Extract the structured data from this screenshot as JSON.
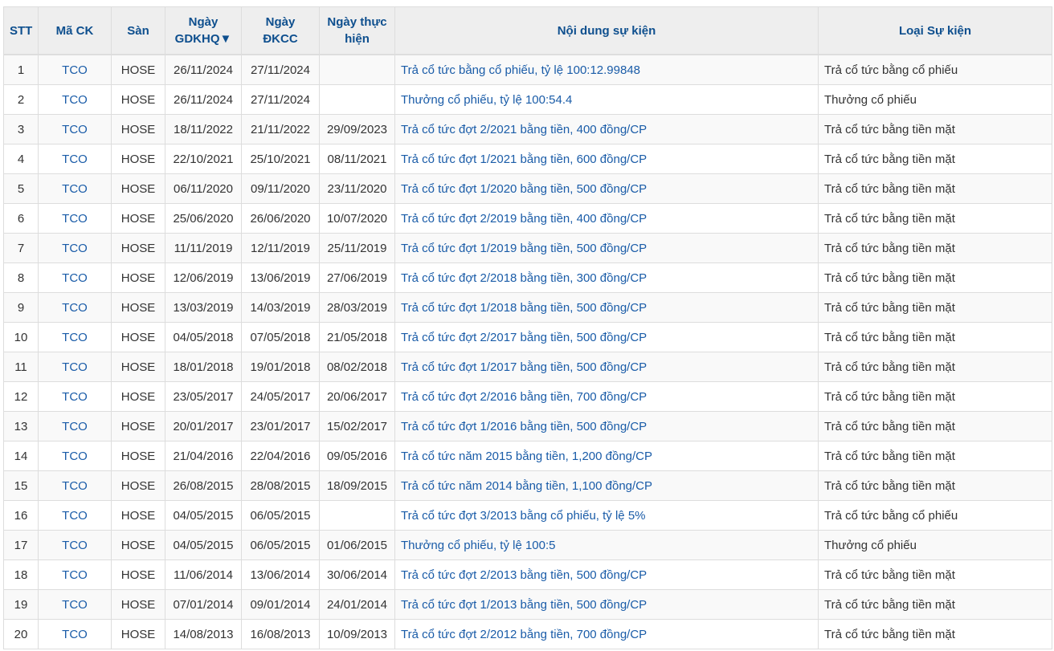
{
  "headers": {
    "stt": "STT",
    "symbol": "Mã CK",
    "exchange": "Sàn",
    "ex_date": "Ngày GDKHQ▼",
    "record_date": "Ngày ĐKCC",
    "exec_date": "Ngày thực hiện",
    "content": "Nội dung sự kiện",
    "type": "Loại Sự kiện"
  },
  "rows": [
    [
      "1",
      "TCO",
      "HOSE",
      "26/11/2024",
      "27/11/2024",
      "",
      "Trả cổ tức bằng cổ phiếu, tỷ lệ 100:12.99848",
      "Trả cổ tức bằng cổ phiếu"
    ],
    [
      "2",
      "TCO",
      "HOSE",
      "26/11/2024",
      "27/11/2024",
      "",
      "Thưởng cổ phiếu, tỷ lệ 100:54.4",
      "Thưởng cổ phiếu"
    ],
    [
      "3",
      "TCO",
      "HOSE",
      "18/11/2022",
      "21/11/2022",
      "29/09/2023",
      "Trả cổ tức đợt 2/2021 bằng tiền, 400 đồng/CP",
      "Trả cổ tức bằng tiền mặt"
    ],
    [
      "4",
      "TCO",
      "HOSE",
      "22/10/2021",
      "25/10/2021",
      "08/11/2021",
      "Trả cổ tức đợt 1/2021 bằng tiền, 600 đồng/CP",
      "Trả cổ tức bằng tiền mặt"
    ],
    [
      "5",
      "TCO",
      "HOSE",
      "06/11/2020",
      "09/11/2020",
      "23/11/2020",
      "Trả cổ tức đợt 1/2020 bằng tiền, 500 đồng/CP",
      "Trả cổ tức bằng tiền mặt"
    ],
    [
      "6",
      "TCO",
      "HOSE",
      "25/06/2020",
      "26/06/2020",
      "10/07/2020",
      "Trả cổ tức đợt 2/2019 bằng tiền, 400 đồng/CP",
      "Trả cổ tức bằng tiền mặt"
    ],
    [
      "7",
      "TCO",
      "HOSE",
      "11/11/2019",
      "12/11/2019",
      "25/11/2019",
      "Trả cổ tức đợt 1/2019 bằng tiền, 500 đồng/CP",
      "Trả cổ tức bằng tiền mặt"
    ],
    [
      "8",
      "TCO",
      "HOSE",
      "12/06/2019",
      "13/06/2019",
      "27/06/2019",
      "Trả cổ tức đợt 2/2018 bằng tiền, 300 đồng/CP",
      "Trả cổ tức bằng tiền mặt"
    ],
    [
      "9",
      "TCO",
      "HOSE",
      "13/03/2019",
      "14/03/2019",
      "28/03/2019",
      "Trả cổ tức đợt 1/2018 bằng tiền, 500 đồng/CP",
      "Trả cổ tức bằng tiền mặt"
    ],
    [
      "10",
      "TCO",
      "HOSE",
      "04/05/2018",
      "07/05/2018",
      "21/05/2018",
      "Trả cổ tức đợt 2/2017 bằng tiền, 500 đồng/CP",
      "Trả cổ tức bằng tiền mặt"
    ],
    [
      "11",
      "TCO",
      "HOSE",
      "18/01/2018",
      "19/01/2018",
      "08/02/2018",
      "Trả cổ tức đợt 1/2017 bằng tiền, 500 đồng/CP",
      "Trả cổ tức bằng tiền mặt"
    ],
    [
      "12",
      "TCO",
      "HOSE",
      "23/05/2017",
      "24/05/2017",
      "20/06/2017",
      "Trả cổ tức đợt 2/2016 bằng tiền, 700 đồng/CP",
      "Trả cổ tức bằng tiền mặt"
    ],
    [
      "13",
      "TCO",
      "HOSE",
      "20/01/2017",
      "23/01/2017",
      "15/02/2017",
      "Trả cổ tức đợt 1/2016 bằng tiền, 500 đồng/CP",
      "Trả cổ tức bằng tiền mặt"
    ],
    [
      "14",
      "TCO",
      "HOSE",
      "21/04/2016",
      "22/04/2016",
      "09/05/2016",
      "Trả cổ tức năm 2015 bằng tiền, 1,200 đồng/CP",
      "Trả cổ tức bằng tiền mặt"
    ],
    [
      "15",
      "TCO",
      "HOSE",
      "26/08/2015",
      "28/08/2015",
      "18/09/2015",
      "Trả cổ tức năm 2014 bằng tiền, 1,100 đồng/CP",
      "Trả cổ tức bằng tiền mặt"
    ],
    [
      "16",
      "TCO",
      "HOSE",
      "04/05/2015",
      "06/05/2015",
      "",
      "Trả cổ tức đợt 3/2013 bằng cổ phiếu, tỷ lệ 5%",
      "Trả cổ tức bằng cổ phiếu"
    ],
    [
      "17",
      "TCO",
      "HOSE",
      "04/05/2015",
      "06/05/2015",
      "01/06/2015",
      "Thưởng cổ phiếu, tỷ lệ 100:5",
      "Thưởng cổ phiếu"
    ],
    [
      "18",
      "TCO",
      "HOSE",
      "11/06/2014",
      "13/06/2014",
      "30/06/2014",
      "Trả cổ tức đợt 2/2013 bằng tiền, 500 đồng/CP",
      "Trả cổ tức bằng tiền mặt"
    ],
    [
      "19",
      "TCO",
      "HOSE",
      "07/01/2014",
      "09/01/2014",
      "24/01/2014",
      "Trả cổ tức đợt 1/2013 bằng tiền, 500 đồng/CP",
      "Trả cổ tức bằng tiền mặt"
    ],
    [
      "20",
      "TCO",
      "HOSE",
      "14/08/2013",
      "16/08/2013",
      "10/09/2013",
      "Trả cổ tức đợt 2/2012 bằng tiền, 700 đồng/CP",
      "Trả cổ tức bằng tiền mặt"
    ]
  ]
}
